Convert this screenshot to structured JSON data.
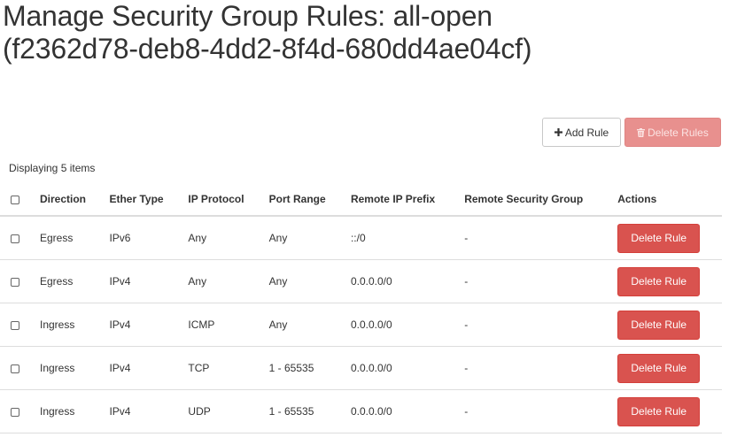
{
  "page": {
    "title": "Manage Security Group Rules: all-open (f2362d78-deb8-4dd2-8f4d-680dd4ae04cf)"
  },
  "toolbar": {
    "add_rule_label": "Add Rule",
    "delete_rules_label": "Delete Rules",
    "add_icon": "plus-icon",
    "delete_icon": "trash-icon"
  },
  "table": {
    "count_text": "Displaying 5 items",
    "headers": {
      "direction": "Direction",
      "ether_type": "Ether Type",
      "ip_protocol": "IP Protocol",
      "port_range": "Port Range",
      "remote_ip_prefix": "Remote IP Prefix",
      "remote_security_group": "Remote Security Group",
      "actions": "Actions"
    },
    "rows": [
      {
        "direction": "Egress",
        "ether_type": "IPv6",
        "ip_protocol": "Any",
        "port_range": "Any",
        "remote_ip_prefix": "::/0",
        "remote_security_group": "-",
        "action_label": "Delete Rule"
      },
      {
        "direction": "Egress",
        "ether_type": "IPv4",
        "ip_protocol": "Any",
        "port_range": "Any",
        "remote_ip_prefix": "0.0.0.0/0",
        "remote_security_group": "-",
        "action_label": "Delete Rule"
      },
      {
        "direction": "Ingress",
        "ether_type": "IPv4",
        "ip_protocol": "ICMP",
        "port_range": "Any",
        "remote_ip_prefix": "0.0.0.0/0",
        "remote_security_group": "-",
        "action_label": "Delete Rule"
      },
      {
        "direction": "Ingress",
        "ether_type": "IPv4",
        "ip_protocol": "TCP",
        "port_range": "1 - 65535",
        "remote_ip_prefix": "0.0.0.0/0",
        "remote_security_group": "-",
        "action_label": "Delete Rule"
      },
      {
        "direction": "Ingress",
        "ether_type": "IPv4",
        "ip_protocol": "UDP",
        "port_range": "1 - 65535",
        "remote_ip_prefix": "0.0.0.0/0",
        "remote_security_group": "-",
        "action_label": "Delete Rule"
      }
    ]
  },
  "colors": {
    "danger": "#d9534f",
    "danger_disabled": "#e8908e",
    "text": "#333333",
    "border": "#dddddd"
  }
}
